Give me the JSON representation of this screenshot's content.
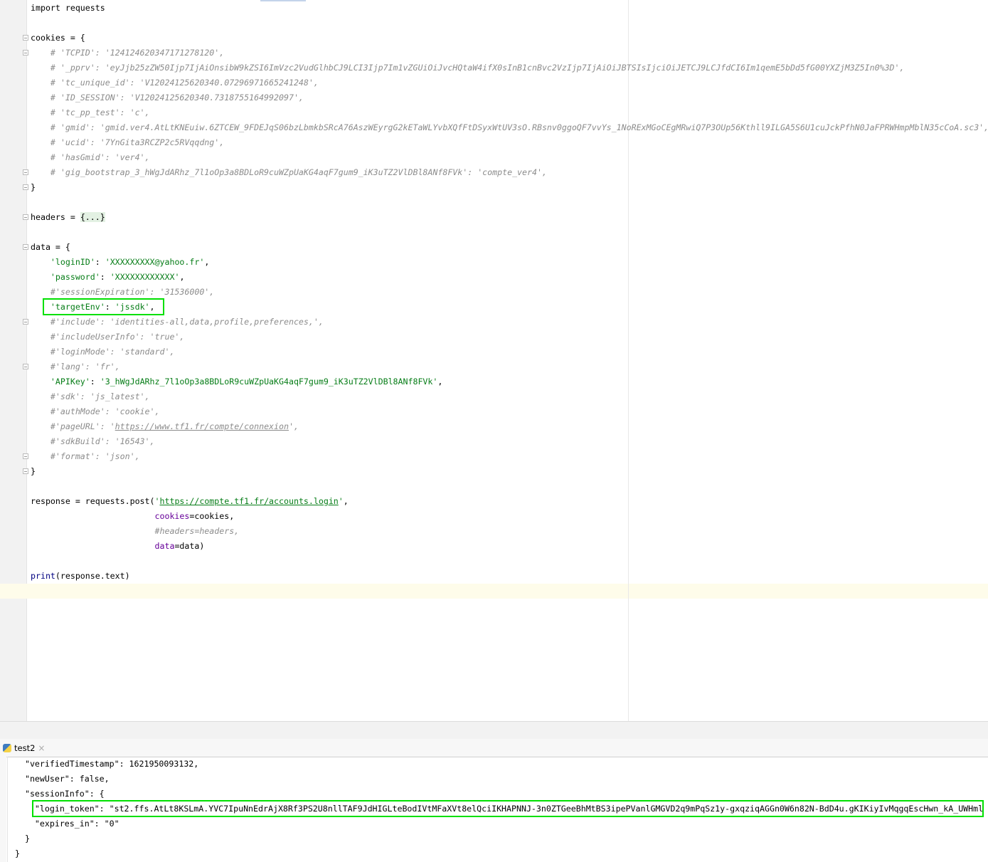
{
  "editor": {
    "lines": [
      [
        [
          "p",
          "import requests"
        ]
      ],
      [],
      [
        [
          "p",
          "cookies = {"
        ]
      ],
      [
        [
          "c",
          "    # 'TCPID': '124124620347171278120',"
        ]
      ],
      [
        [
          "c",
          "    # '_pprv': 'eyJjb25zZW50Ijp7IjAiOnsibW9kZSI6ImVzc2VudGlhbCJ9LCI3Ijp7Im1vZGUiOiJvcHQtaW4ifX0sInB1cnBvc2VzIjp7IjAiOiJBTSIsIjciOiJETCJ9LCJfdCI6Im1qemE5bDd5fG00YXZjM3Z5In0%3D',"
        ]
      ],
      [
        [
          "c",
          "    # 'tc_unique_id': 'V12024125620340.07296971665241248',"
        ]
      ],
      [
        [
          "c",
          "    # 'ID_SESSION': 'V12024125620340.7318755164992097',"
        ]
      ],
      [
        [
          "c",
          "    # 'tc_pp_test': 'c',"
        ]
      ],
      [
        [
          "c",
          "    # 'gmid': 'gmid.ver4.AtLtKNEuiw.6ZTCEW_9FDEJqS06bzLbmkbSRcA76AszWEyrgG2kETaWLYvbXQfFtDSyxWtUV3sO.RBsnv0ggoQF7vvYs_1NoRExMGoCEgMRwiQ7P3OUp56Kthll9ILGA5S6U1cuJckPfhN0JaFPRWHmpMblN35cCoA.sc3',"
        ]
      ],
      [
        [
          "c",
          "    # 'ucid': '7YnGita3RCZP2c5RVqqdng',"
        ]
      ],
      [
        [
          "c",
          "    # 'hasGmid': 'ver4',"
        ]
      ],
      [
        [
          "c",
          "    # 'gig_bootstrap_3_hWgJdARhz_7l1oOp3a8BDLoR9cuWZpUaKG4aqF7gum9_iK3uTZ2VlDBl8ANf8FVk': 'compte_ver4',"
        ]
      ],
      [
        [
          "p",
          "}"
        ]
      ],
      [],
      [
        [
          "p",
          "headers = "
        ],
        [
          "f",
          "{...}"
        ]
      ],
      [],
      [
        [
          "p",
          "data = {"
        ]
      ],
      [
        [
          "p",
          "    "
        ],
        [
          "s",
          "'loginID'"
        ],
        [
          "p",
          ": "
        ],
        [
          "s",
          "'XXXXXXXXX@yahoo.fr'"
        ],
        [
          "p",
          ","
        ]
      ],
      [
        [
          "p",
          "    "
        ],
        [
          "s",
          "'password'"
        ],
        [
          "p",
          ": "
        ],
        [
          "s",
          "'XXXXXXXXXXXX'"
        ],
        [
          "p",
          ","
        ]
      ],
      [
        [
          "c",
          "    #'sessionExpiration': '31536000',"
        ]
      ],
      [
        [
          "p",
          "    "
        ],
        [
          "s",
          "'targetEnv'"
        ],
        [
          "p",
          ": "
        ],
        [
          "s",
          "'jssdk'"
        ],
        [
          "p",
          ","
        ]
      ],
      [
        [
          "c",
          "    #'include': 'identities-all,data,profile,preferences,',"
        ]
      ],
      [
        [
          "c",
          "    #'includeUserInfo': 'true',"
        ]
      ],
      [
        [
          "c",
          "    #'loginMode': 'standard',"
        ]
      ],
      [
        [
          "c",
          "    #'lang': 'fr',"
        ]
      ],
      [
        [
          "p",
          "    "
        ],
        [
          "s",
          "'APIKey'"
        ],
        [
          "p",
          ": "
        ],
        [
          "s",
          "'3_hWgJdARhz_7l1oOp3a8BDLoR9cuWZpUaKG4aqF7gum9_iK3uTZ2VlDBl8ANf8FVk'"
        ],
        [
          "p",
          ","
        ]
      ],
      [
        [
          "c",
          "    #'sdk': 'js_latest',"
        ]
      ],
      [
        [
          "c",
          "    #'authMode': 'cookie',"
        ]
      ],
      [
        [
          "c",
          "    #'pageURL': '"
        ],
        [
          "cu",
          "https://www.tf1.fr/compte/connexion"
        ],
        [
          "c",
          "',"
        ]
      ],
      [
        [
          "c",
          "    #'sdkBuild': '16543',"
        ]
      ],
      [
        [
          "c",
          "    #'format': 'json',"
        ]
      ],
      [
        [
          "p",
          "}"
        ]
      ],
      [],
      [
        [
          "p",
          "response = requests.post("
        ],
        [
          "s",
          "'"
        ],
        [
          "su",
          "https://compte.tf1.fr/accounts.login"
        ],
        [
          "s",
          "'"
        ],
        [
          "p",
          ","
        ]
      ],
      [
        [
          "p",
          "                         "
        ],
        [
          "kw",
          "cookies"
        ],
        [
          "p",
          "=cookies,"
        ]
      ],
      [
        [
          "c",
          "                         #headers=headers,"
        ]
      ],
      [
        [
          "p",
          "                         "
        ],
        [
          "kw",
          "data"
        ],
        [
          "p",
          "=data)"
        ]
      ],
      [],
      [
        [
          "b",
          "print"
        ],
        [
          "p",
          "(response.text)"
        ]
      ]
    ]
  },
  "run_panel": {
    "tab_label": "test2",
    "close_icon": "×",
    "lines": [
      "    \"verifiedTimestamp\": 1621950093132,",
      "    \"newUser\": false,",
      "    \"sessionInfo\": {",
      "      \"login_token\": \"st2.ffs.AtLt8KSLmA.YVC7IpuNnEdrAjX8Rf3PS2U8nllTAF9JdHIGLteBodIVtMFaXVt8elQciIKHAPNNJ-3n0ZTGeeBhMtBS3ipePVanlGMGVD2q9mPqSz1y-gxqziqAGGn0W6n82N-BdD4u.gKIKiyIvMqgqEscHwn_kA_UWHml",
      "      \"expires_in\": \"0\"",
      "    }",
      "  }"
    ]
  }
}
